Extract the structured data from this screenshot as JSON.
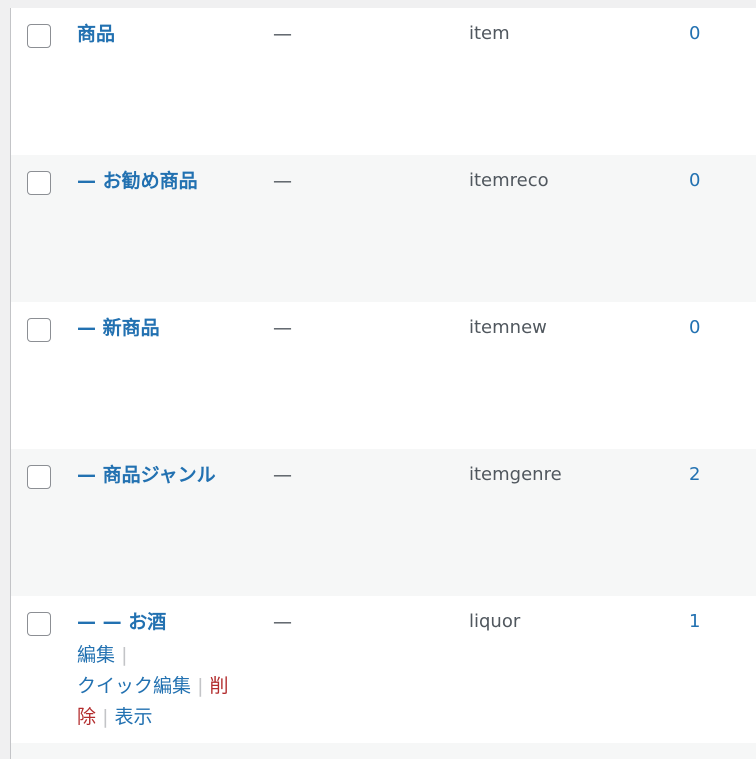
{
  "rows": [
    {
      "name": "商品",
      "description": "—",
      "slug": "item",
      "count": "0"
    },
    {
      "name": "— お勧め商品",
      "description": "—",
      "slug": "itemreco",
      "count": "0"
    },
    {
      "name": "— 新商品",
      "description": "—",
      "slug": "itemnew",
      "count": "0"
    },
    {
      "name": "— 商品ジャンル",
      "description": "—",
      "slug": "itemgenre",
      "count": "2"
    },
    {
      "name": "— — お酒",
      "description": "—",
      "slug": "liquor",
      "count": "1"
    }
  ],
  "row_actions": {
    "edit": "編集",
    "quick_edit": "クイック編集",
    "delete_part1": "削",
    "delete_part2": "除",
    "view": "表示",
    "separator": "|"
  }
}
